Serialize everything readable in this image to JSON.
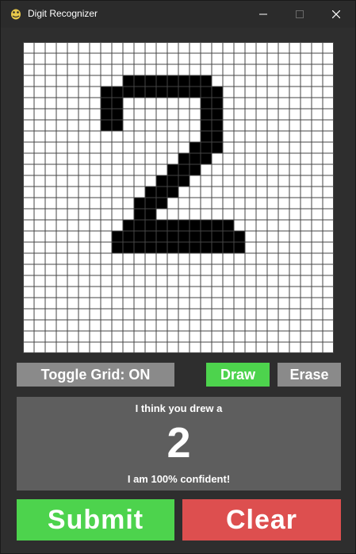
{
  "window": {
    "title": "Digit Recognizer"
  },
  "canvas": {
    "columns": 28,
    "rows": 28,
    "grid_visible": true,
    "drawn_cells": [
      [
        3,
        9
      ],
      [
        3,
        10
      ],
      [
        3,
        11
      ],
      [
        3,
        12
      ],
      [
        3,
        13
      ],
      [
        3,
        14
      ],
      [
        3,
        15
      ],
      [
        3,
        16
      ],
      [
        4,
        7
      ],
      [
        4,
        8
      ],
      [
        4,
        9
      ],
      [
        4,
        10
      ],
      [
        4,
        11
      ],
      [
        4,
        12
      ],
      [
        4,
        13
      ],
      [
        4,
        14
      ],
      [
        4,
        15
      ],
      [
        4,
        16
      ],
      [
        4,
        17
      ],
      [
        5,
        7
      ],
      [
        5,
        8
      ],
      [
        5,
        16
      ],
      [
        5,
        17
      ],
      [
        6,
        7
      ],
      [
        6,
        8
      ],
      [
        6,
        16
      ],
      [
        6,
        17
      ],
      [
        7,
        7
      ],
      [
        7,
        8
      ],
      [
        7,
        16
      ],
      [
        7,
        17
      ],
      [
        8,
        16
      ],
      [
        8,
        17
      ],
      [
        9,
        15
      ],
      [
        9,
        16
      ],
      [
        9,
        17
      ],
      [
        10,
        14
      ],
      [
        10,
        15
      ],
      [
        10,
        16
      ],
      [
        11,
        13
      ],
      [
        11,
        14
      ],
      [
        11,
        15
      ],
      [
        12,
        12
      ],
      [
        12,
        13
      ],
      [
        12,
        14
      ],
      [
        13,
        11
      ],
      [
        13,
        12
      ],
      [
        13,
        13
      ],
      [
        14,
        10
      ],
      [
        14,
        11
      ],
      [
        14,
        12
      ],
      [
        15,
        10
      ],
      [
        15,
        11
      ],
      [
        16,
        9
      ],
      [
        16,
        10
      ],
      [
        16,
        11
      ],
      [
        16,
        12
      ],
      [
        16,
        13
      ],
      [
        16,
        14
      ],
      [
        16,
        15
      ],
      [
        16,
        16
      ],
      [
        16,
        17
      ],
      [
        16,
        18
      ],
      [
        17,
        8
      ],
      [
        17,
        9
      ],
      [
        17,
        10
      ],
      [
        17,
        11
      ],
      [
        17,
        12
      ],
      [
        17,
        13
      ],
      [
        17,
        14
      ],
      [
        17,
        15
      ],
      [
        17,
        16
      ],
      [
        17,
        17
      ],
      [
        17,
        18
      ],
      [
        17,
        19
      ],
      [
        18,
        8
      ],
      [
        18,
        9
      ],
      [
        18,
        10
      ],
      [
        18,
        11
      ],
      [
        18,
        12
      ],
      [
        18,
        13
      ],
      [
        18,
        14
      ],
      [
        18,
        15
      ],
      [
        18,
        16
      ],
      [
        18,
        17
      ],
      [
        18,
        18
      ],
      [
        18,
        19
      ]
    ]
  },
  "controls": {
    "toggle_grid_label": "Toggle Grid: ON",
    "draw_label": "Draw",
    "erase_label": "Erase",
    "active_tool": "draw"
  },
  "result": {
    "prompt": "I think you drew a",
    "digit": "2",
    "confidence_text": "I am 100% confident!"
  },
  "actions": {
    "submit_label": "Submit",
    "clear_label": "Clear"
  },
  "colors": {
    "window_bg": "#2e2e2e",
    "panel_bg": "#5e5e5e",
    "green": "#4dd34d",
    "red": "#dd4f4f",
    "gray_button": "#8a8a8a",
    "ink": "#000000",
    "paper": "#ffffff"
  }
}
